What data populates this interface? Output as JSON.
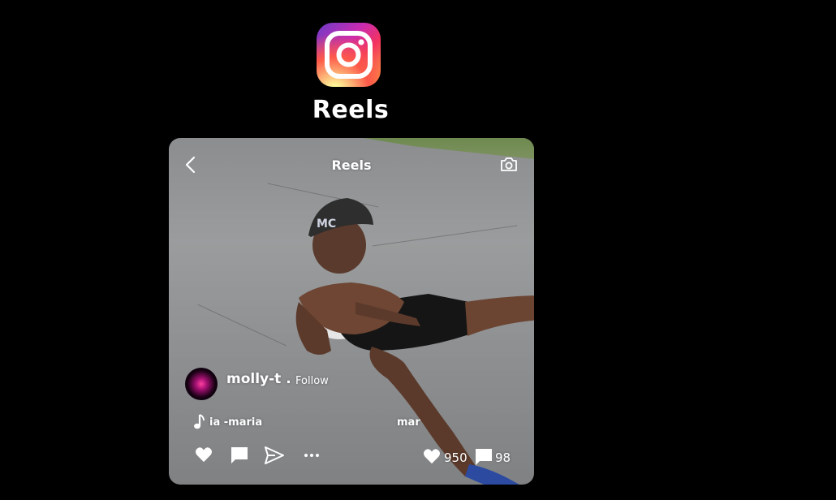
{
  "app": {
    "title": "Reels",
    "logo_icon": "instagram-logo"
  },
  "reel": {
    "heading": "Reels",
    "back_icon": "chevron-left-icon",
    "camera_icon": "camera-icon",
    "author": {
      "name": "molly-t .",
      "follow_label": "Follow"
    },
    "audio": {
      "icon": "music-note-icon",
      "text": "ia -maria",
      "extra": "mar"
    },
    "actions": {
      "like_icon": "heart-icon",
      "comment_icon": "comment-icon",
      "share_icon": "send-icon",
      "more_icon": "more-icon"
    },
    "stats": {
      "likes": "950",
      "comments": "98"
    }
  },
  "colors": {
    "background": "#000000",
    "text": "#ffffff"
  }
}
